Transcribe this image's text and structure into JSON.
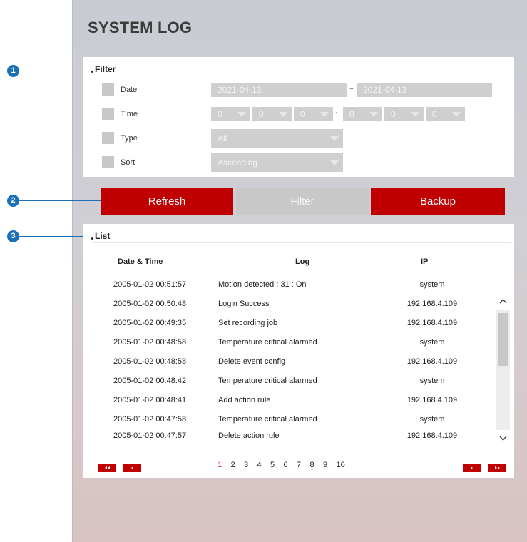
{
  "page_title": "SYSTEM LOG",
  "callouts": [
    "1",
    "2",
    "3"
  ],
  "filter": {
    "heading": "Filter",
    "date": {
      "label": "Date",
      "from": "2021-04-13",
      "separator": "~",
      "to": "2021-04-13"
    },
    "time": {
      "label": "Time",
      "from": [
        "0",
        "0",
        "0"
      ],
      "separator": "~",
      "to": [
        "0",
        "0",
        "0"
      ]
    },
    "type": {
      "label": "Type",
      "value": "All"
    },
    "sort": {
      "label": "Sort",
      "value": "Ascending"
    }
  },
  "buttons": {
    "refresh": "Refresh",
    "filter": "Filter",
    "backup": "Backup"
  },
  "list": {
    "heading": "List",
    "columns": [
      "Date & Time",
      "Log",
      "IP"
    ],
    "rows": [
      {
        "datetime": "2005-01-02 00:51:57",
        "log": "Motion detected : 31 : On",
        "ip": "system"
      },
      {
        "datetime": "2005-01-02 00:50:48",
        "log": "Login Success",
        "ip": "192.168.4.109"
      },
      {
        "datetime": "2005-01-02 00:49:35",
        "log": "Set recording job",
        "ip": "192.168.4.109"
      },
      {
        "datetime": "2005-01-02 00:48:58",
        "log": "Temperature critical alarmed",
        "ip": "system"
      },
      {
        "datetime": "2005-01-02 00:48:58",
        "log": "Delete event config",
        "ip": "192.168.4.109"
      },
      {
        "datetime": "2005-01-02 00:48:42",
        "log": "Temperature critical alarmed",
        "ip": "system"
      },
      {
        "datetime": "2005-01-02 00:48:41",
        "log": "Add action rule",
        "ip": "192.168.4.109"
      },
      {
        "datetime": "2005-01-02 00:47:58",
        "log": "Temperature critical alarmed",
        "ip": "system"
      },
      {
        "datetime": "2005-01-02 00:47:57",
        "log": "Delete action rule",
        "ip": "192.168.4.109"
      }
    ]
  },
  "pagination": {
    "pages": [
      "1",
      "2",
      "3",
      "4",
      "5",
      "6",
      "7",
      "8",
      "9",
      "10"
    ],
    "current": "1"
  },
  "colors": {
    "accent": "#c00000",
    "callout": "#1a6fb6",
    "disabled": "#c8c8c8"
  },
  "icons": [
    "first-page-icon",
    "prev-page-icon",
    "next-page-icon",
    "last-page-icon",
    "chevron-up-icon",
    "chevron-down-icon"
  ]
}
